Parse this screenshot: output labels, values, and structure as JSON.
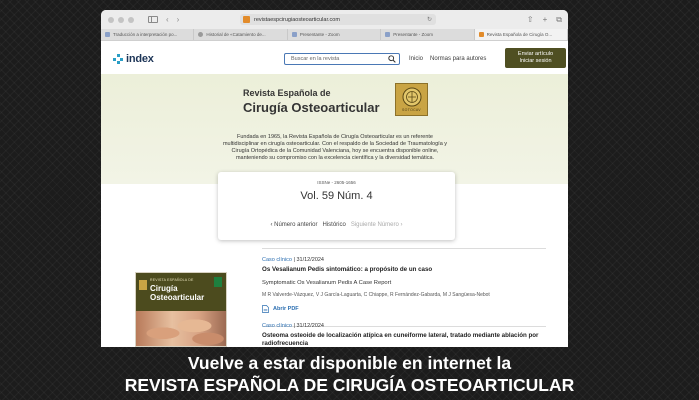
{
  "browser": {
    "url": "revistaespcirugiaosteoarticular.com",
    "tabs": [
      {
        "label": "Traducción a interpretación po..."
      },
      {
        "label": "Historial de «Catamiento de..."
      },
      {
        "label": "Presentante - Zoom"
      },
      {
        "label": "Presentante - Zoom"
      },
      {
        "label": "Revista Española de Cirugía O..."
      }
    ]
  },
  "site": {
    "logo": "index",
    "search_placeholder": "Buscar en la revista",
    "nav": [
      "Inicio",
      "Normas para autores"
    ],
    "cta_line1": "Enviar artículo",
    "cta_line2": "Iniciar sesión"
  },
  "hero": {
    "title_line1": "Revista Española de",
    "title_line2": "Cirugía Osteoarticular",
    "seal_label": "SOTOCAV",
    "description": "Fundada en 1965, la Revista Española de Cirugía Osteoarticular es un referente multidisciplinar en cirugía osteoarticular. Con el respaldo de la Sociedad de Traumatología y Cirugía Ortopédica de la Comunidad Valenciana, hoy se encuentra disponible online, manteniendo su compromiso con la excelencia científica y la diversidad temática."
  },
  "issue": {
    "issn": "ISSNe - 2605-1656",
    "volume": "Vol. 59 Núm. 4",
    "prev": "‹ Número anterior",
    "history": "Histórico",
    "next": "Siguiente Número ›"
  },
  "cover": {
    "small": "REVISTA ESPAÑOLA DE",
    "line1": "Cirugía",
    "line2": "Osteoarticular"
  },
  "articles": [
    {
      "category": "Caso clínico",
      "date": "31/12/2024",
      "title": "Os Vesalianum Pedis sintomático: a propósito de un caso",
      "subtitle": "Symptomatic Os Vesalianum Pedis A Case Report",
      "authors": "M R Valverde-Vázquez, V J García-Laguarta, C Chiappe, R Fernández-Gabarda, M J Sangüesa-Nebot",
      "pdf_label": "Abrir PDF"
    },
    {
      "category": "Caso clínico",
      "date": "31/12/2024",
      "title": "Osteoma osteoide de localización atípica en cuneiforme lateral, tratado mediante ablación por radiofrecuencia"
    }
  ],
  "caption": {
    "line1": "Vuelve a estar disponible en internet la",
    "line2": "REVISTA ESPAÑOLA DE CIRUGÍA  OSTEOARTICULAR"
  }
}
